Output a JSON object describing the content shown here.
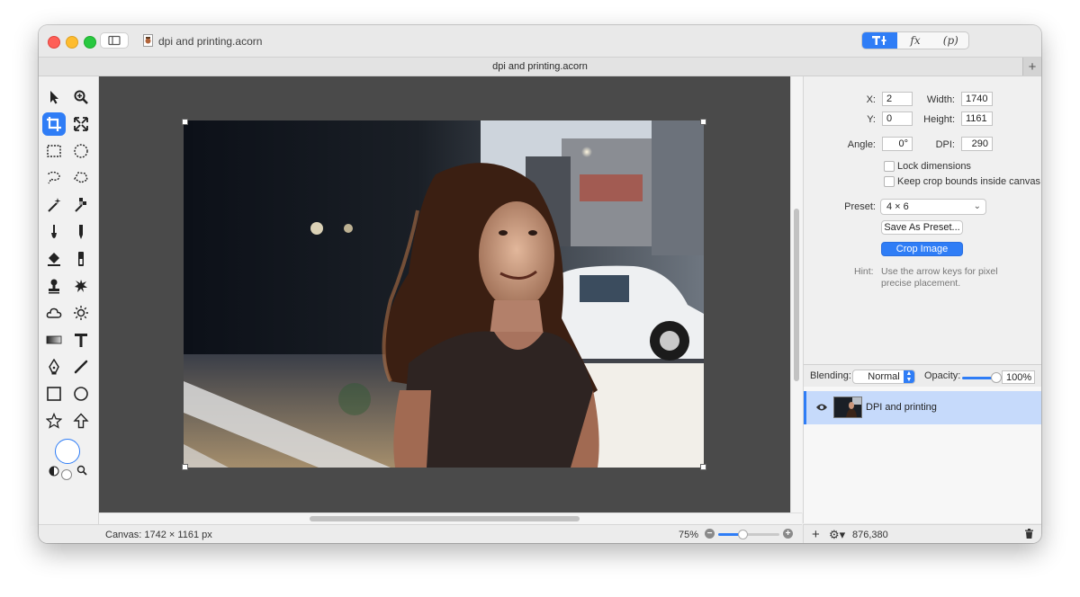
{
  "window": {
    "title": "dpi and printing.acorn",
    "document_title": "dpi and printing.acorn"
  },
  "toolbar": {
    "segments": [
      "",
      "fx",
      "(p)"
    ]
  },
  "crop": {
    "x_label": "X:",
    "x_value": "2",
    "y_label": "Y:",
    "y_value": "0",
    "width_label": "Width:",
    "width_value": "1740",
    "height_label": "Height:",
    "height_value": "1161",
    "angle_label": "Angle:",
    "angle_value": "0°",
    "dpi_label": "DPI:",
    "dpi_value": "290",
    "lock_dimensions": "Lock dimensions",
    "keep_bounds": "Keep crop bounds inside canvas",
    "preset_label": "Preset:",
    "preset_value": "4 × 6",
    "save_preset": "Save As Preset...",
    "crop_button": "Crop Image",
    "hint_label": "Hint:",
    "hint_text": "Use the arrow keys for pixel precise placement."
  },
  "status": {
    "canvas": "Canvas: 1742 × 1161 px",
    "zoom": "75%",
    "zoom_level": 0.4
  },
  "layers": {
    "blending_label": "Blending:",
    "blending_value": "Normal",
    "opacity_label": "Opacity:",
    "opacity_value": "100%",
    "items": [
      {
        "name": "DPI and printing"
      }
    ],
    "coords": "876,380"
  },
  "colors": {
    "accent": "#2f7df6",
    "canvas_bg": "#4a4a4a",
    "selected_layer": "#c6dafb"
  }
}
